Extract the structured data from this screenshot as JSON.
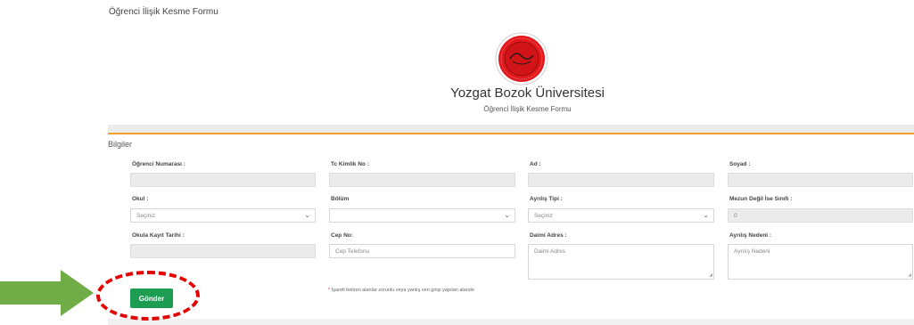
{
  "page": {
    "title": "Öğrenci İlişik Kesme Formu"
  },
  "header": {
    "university": "Yozgat Bozok Üniversitesi",
    "form_title": "Öğrenci İlişik Kesme Formu"
  },
  "section": {
    "label": "Bilgiler"
  },
  "fields": {
    "ogrenci_no": {
      "label": "Öğrenci Numarası :",
      "value": ""
    },
    "tc_no": {
      "label": "Tc Kimlik No :",
      "value": ""
    },
    "ad": {
      "label": "Ad :",
      "value": ""
    },
    "soyad": {
      "label": "Soyad :",
      "value": ""
    },
    "okul": {
      "label": "Okul :",
      "value": "Seçiniz"
    },
    "bolum": {
      "label": "Bölüm",
      "value": ""
    },
    "ayrilis_tipi": {
      "label": "Ayrılış Tipi :",
      "value": "Seçiniz"
    },
    "mezun_sinif": {
      "label": "Mezun Değil İse Sınıfı :",
      "value": "0"
    },
    "kayit_tarihi": {
      "label": "Okula Kayıt Tarihi :",
      "value": ""
    },
    "cep_no": {
      "label": "Cep No:",
      "placeholder": "Cep Telefonu"
    },
    "adres": {
      "label": "Daimi Adres :",
      "placeholder": "Daimi Adres"
    },
    "ayrilis_nedeni": {
      "label": "Ayrılış Nedeni :",
      "placeholder": "Ayrılış Nedeni"
    }
  },
  "submit": {
    "label": "Gönder"
  },
  "note": {
    "star": "*",
    "text": "İşareti beliren alanlar zorunlu veya yanlış veri girişi yapılan alandır"
  },
  "colors": {
    "accent": "#f0a12b",
    "submit": "#1c9d52",
    "annotation": "#e60000",
    "arrow": "#70ad47",
    "logo": "#e3181c"
  },
  "icons": {
    "logo": "university-seal-icon",
    "select": "chevron-down-icon",
    "pointer": "right-arrow-icon"
  }
}
